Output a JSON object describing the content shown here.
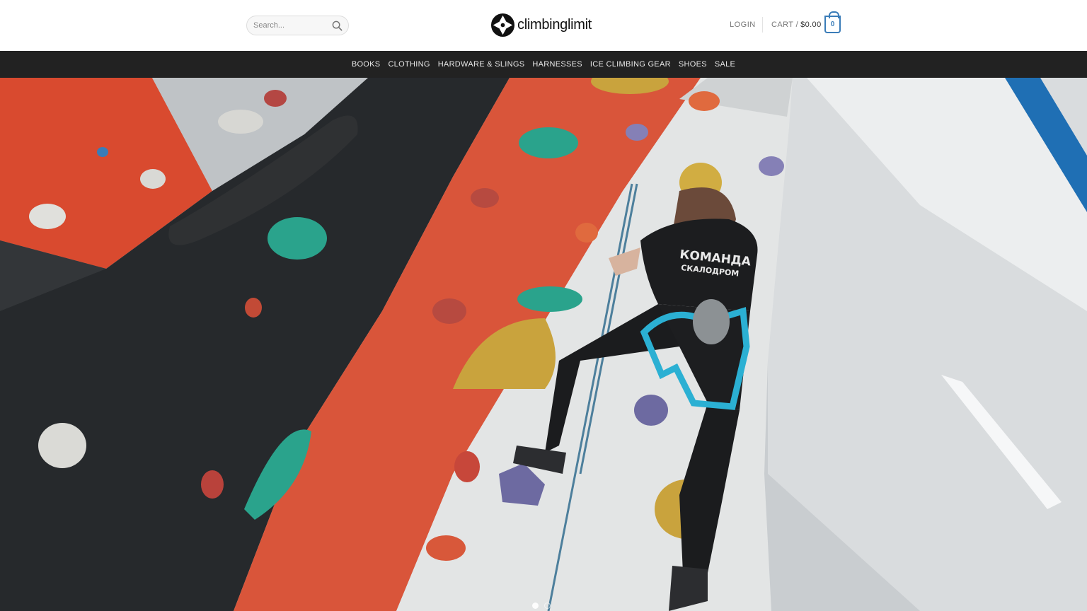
{
  "header": {
    "search": {
      "placeholder": "Search..."
    },
    "logo": {
      "text": "climbinglimit"
    },
    "login_label": "LOGIN",
    "cart": {
      "label": "CART /",
      "amount": "$0.00",
      "count": "0"
    },
    "accent_color": "#3a7cb8"
  },
  "nav": {
    "items": [
      "BOOKS",
      "CLOTHING",
      "HARDWARE & SLINGS",
      "HARNESSES",
      "ICE CLIMBING GEAR",
      "SHOES",
      "SALE"
    ],
    "background": "#222222"
  },
  "hero": {
    "shirt_line1": "КОМАНДА",
    "shirt_line2": "СКАЛОДРОМ",
    "slides": {
      "total": 2,
      "active": 1
    }
  }
}
